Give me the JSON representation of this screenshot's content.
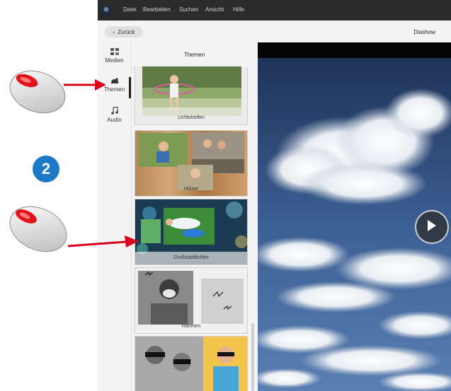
{
  "menubar": {
    "items": [
      "Datei",
      "Bearbeiten",
      "Suchen",
      "Ansicht",
      "Hilfe"
    ]
  },
  "toolbar": {
    "back_label": "Zurück",
    "title": "Diashow"
  },
  "nav": {
    "items": [
      {
        "label": "Medien",
        "icon": "media-icon"
      },
      {
        "label": "Themen",
        "icon": "themes-icon",
        "active": true
      },
      {
        "label": "Audio",
        "icon": "music-note-icon"
      }
    ]
  },
  "themes": {
    "header": "Themen",
    "items": [
      {
        "label": "Lichtstreifen"
      },
      {
        "label": "Hölzer"
      },
      {
        "label": "Großstadtlichter"
      },
      {
        "label": "Rahmen"
      },
      {
        "label": ""
      }
    ]
  },
  "annotation": {
    "step_number": "2",
    "accent_color": "#1e78c8",
    "arrow_color": "#d9001b"
  },
  "colors": {
    "menubar": "#2b2b2b",
    "panel": "#f4f4f4"
  }
}
